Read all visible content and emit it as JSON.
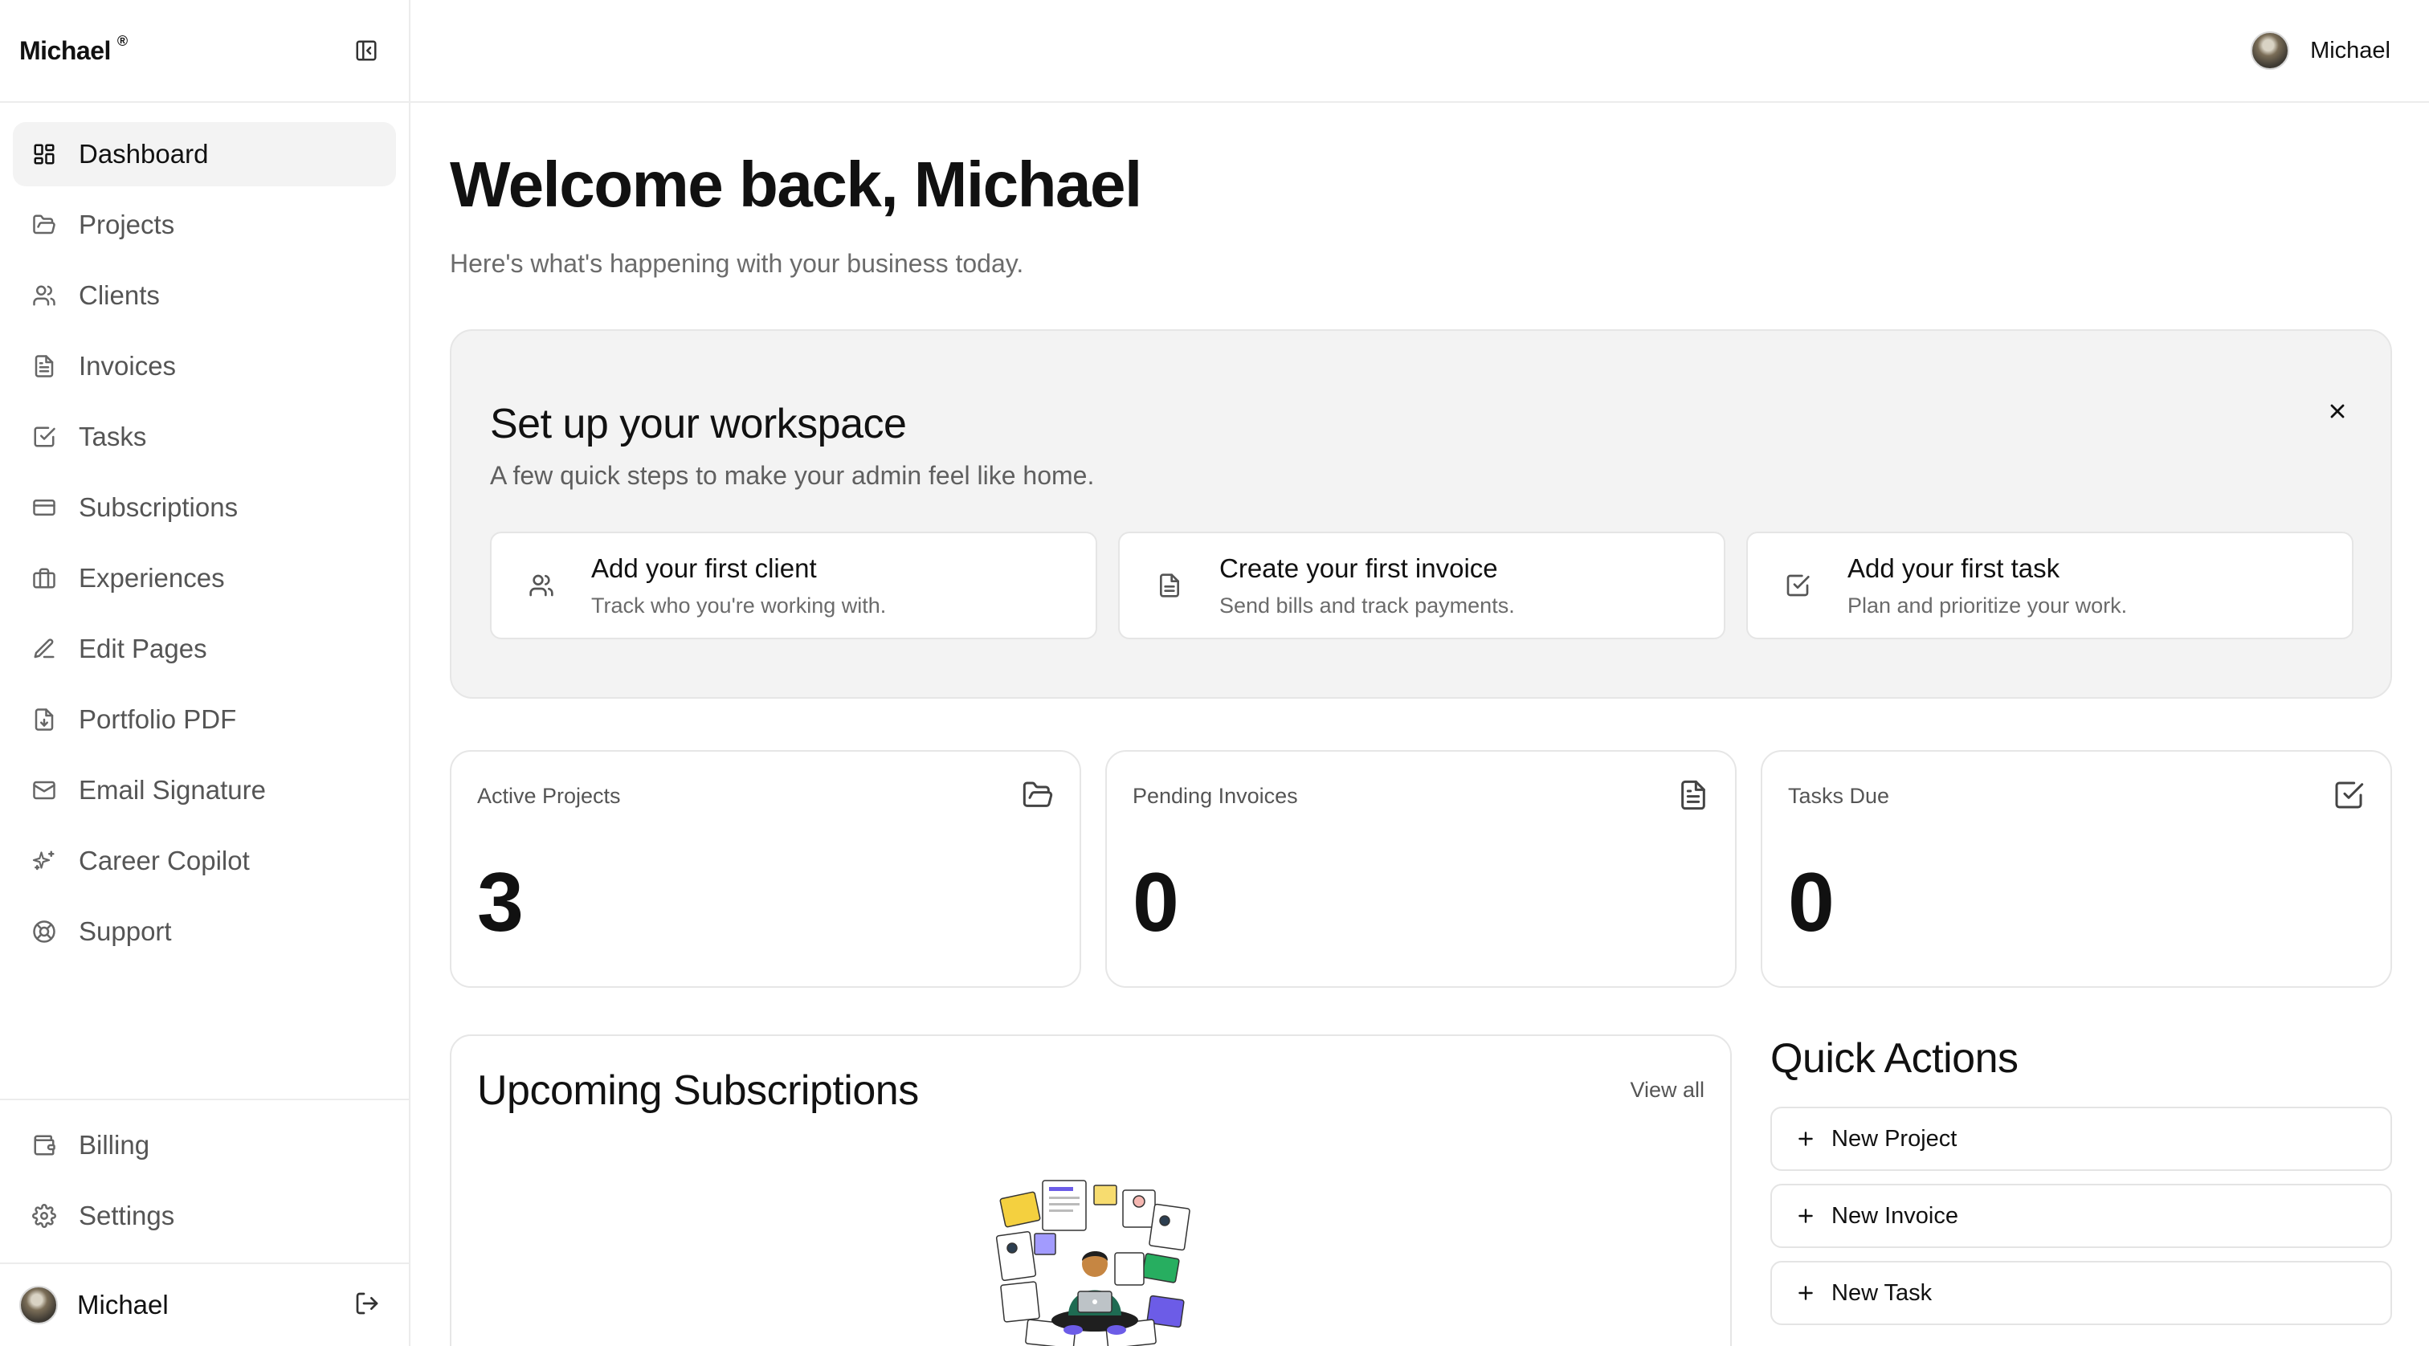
{
  "brand": {
    "name": "Michael",
    "mark": "®"
  },
  "sidebar": {
    "items": [
      {
        "label": "Dashboard",
        "icon": "layout-grid-icon",
        "active": true
      },
      {
        "label": "Projects",
        "icon": "folder-icon"
      },
      {
        "label": "Clients",
        "icon": "users-icon"
      },
      {
        "label": "Invoices",
        "icon": "file-text-icon"
      },
      {
        "label": "Tasks",
        "icon": "check-square-icon"
      },
      {
        "label": "Subscriptions",
        "icon": "credit-card-icon"
      },
      {
        "label": "Experiences",
        "icon": "briefcase-icon"
      },
      {
        "label": "Edit Pages",
        "icon": "pen-icon"
      },
      {
        "label": "Portfolio PDF",
        "icon": "file-download-icon"
      },
      {
        "label": "Email Signature",
        "icon": "mail-icon"
      },
      {
        "label": "Career Copilot",
        "icon": "sparkles-icon"
      },
      {
        "label": "Support",
        "icon": "life-buoy-icon"
      }
    ],
    "bottom_items": [
      {
        "label": "Billing",
        "icon": "wallet-icon"
      },
      {
        "label": "Settings",
        "icon": "gear-icon"
      }
    ],
    "user": {
      "name": "Michael"
    }
  },
  "topbar": {
    "user_name": "Michael"
  },
  "main": {
    "title": "Welcome back, Michael",
    "subtitle": "Here's what's happening with your business today."
  },
  "setup": {
    "title": "Set up your workspace",
    "subtitle": "A few quick steps to make your admin feel like home.",
    "cards": [
      {
        "title": "Add your first client",
        "subtitle": "Track who you're working with."
      },
      {
        "title": "Create your first invoice",
        "subtitle": "Send bills and track payments."
      },
      {
        "title": "Add your first task",
        "subtitle": "Plan and prioritize your work."
      }
    ]
  },
  "stats": [
    {
      "label": "Active Projects",
      "value": "3"
    },
    {
      "label": "Pending Invoices",
      "value": "0"
    },
    {
      "label": "Tasks Due",
      "value": "0"
    }
  ],
  "subscriptions": {
    "title": "Upcoming Subscriptions",
    "view_all": "View all"
  },
  "quick_actions": {
    "title": "Quick Actions",
    "buttons": [
      "New Project",
      "New Invoice",
      "New Task"
    ]
  }
}
